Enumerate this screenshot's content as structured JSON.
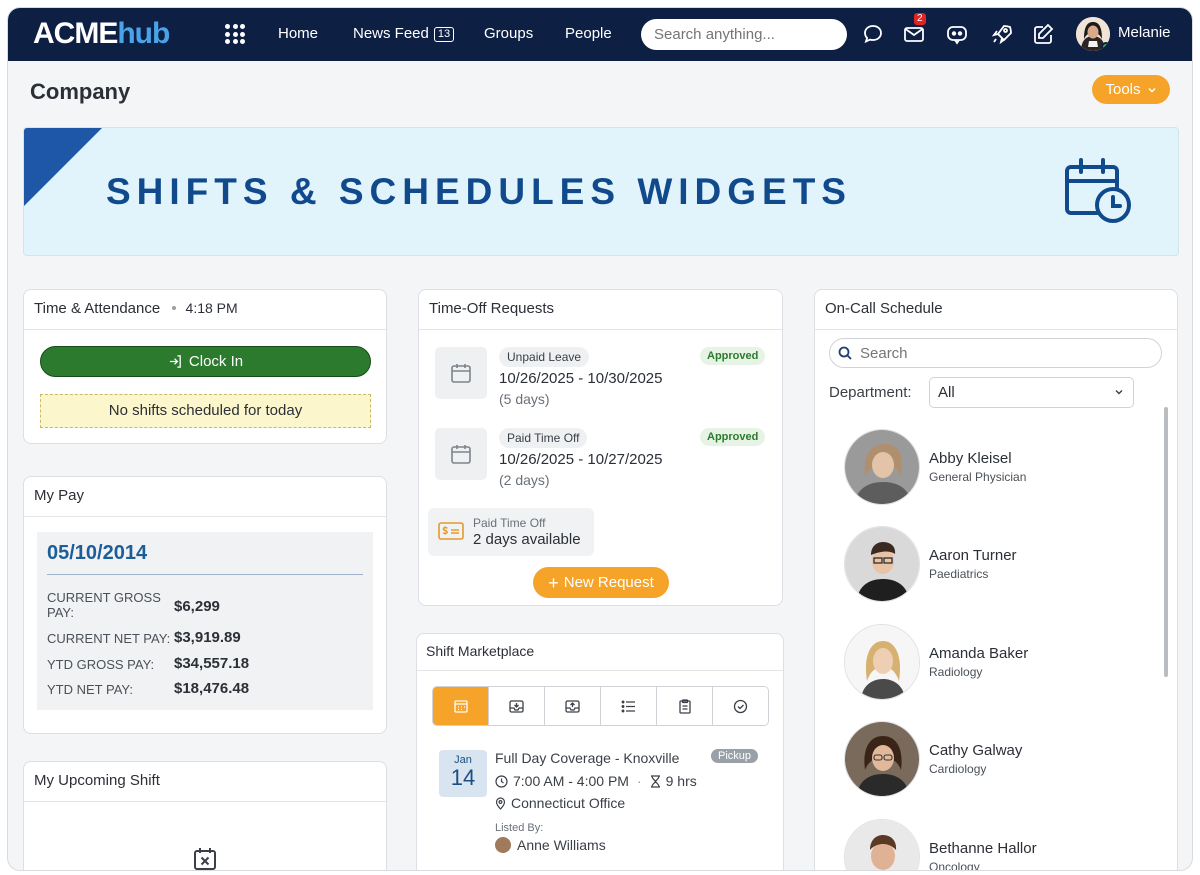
{
  "nav": {
    "logo_main": "ACME",
    "logo_accent": "hub",
    "links": {
      "home": "Home",
      "news_feed": "News Feed",
      "groups": "Groups",
      "people": "People"
    },
    "news_feed_count": "13",
    "search_placeholder": "Search anything...",
    "mail_badge": "2",
    "user_name": "Melanie"
  },
  "page": {
    "title": "Company",
    "tools_label": "Tools"
  },
  "banner": {
    "title": "SHIFTS & SCHEDULES WIDGETS"
  },
  "time_attendance": {
    "title": "Time & Attendance",
    "time": "4:18 PM",
    "clock_in_label": "Clock In",
    "no_shift_text": "No shifts scheduled for today"
  },
  "my_pay": {
    "title": "My Pay",
    "date": "05/10/2014",
    "rows": [
      {
        "label": "CURRENT GROSS PAY:",
        "value": "$6,299"
      },
      {
        "label": "CURRENT NET PAY:",
        "value": "$3,919.89"
      },
      {
        "label": "YTD GROSS PAY:",
        "value": "$34,557.18"
      },
      {
        "label": "YTD NET PAY:",
        "value": "$18,476.48"
      }
    ]
  },
  "upcoming_shift": {
    "title": "My Upcoming Shift"
  },
  "time_off": {
    "title": "Time-Off Requests",
    "requests": [
      {
        "type": "Unpaid Leave",
        "range": "10/26/2025 - 10/30/2025",
        "days": "(5 days)",
        "status": "Approved"
      },
      {
        "type": "Paid Time Off",
        "range": "10/26/2025 - 10/27/2025",
        "days": "(2 days)",
        "status": "Approved"
      }
    ],
    "balance_label": "Paid Time Off",
    "balance_value": "2 days available",
    "new_request_label": "New Request"
  },
  "shift_marketplace": {
    "title": "Shift Marketplace",
    "tab_icons": [
      "calendar-grid-icon",
      "inbox-download-icon",
      "inbox-upload-icon",
      "list-icon",
      "clipboard-icon",
      "check-circle-icon"
    ],
    "shift": {
      "month": "Jan",
      "day": "14",
      "title": "Full Day Coverage - Knoxville",
      "tag": "Pickup",
      "time": "7:00 AM - 4:00 PM",
      "duration": "9 hrs",
      "location": "Connecticut Office",
      "listed_by_label": "Listed By:",
      "listed_by": "Anne Williams"
    }
  },
  "on_call": {
    "title": "On-Call Schedule",
    "search_placeholder": "Search",
    "department_label": "Department:",
    "department_value": "All",
    "people": [
      {
        "name": "Abby Kleisel",
        "dept": "General Physician"
      },
      {
        "name": "Aaron Turner",
        "dept": "Paediatrics"
      },
      {
        "name": "Amanda Baker",
        "dept": "Radiology"
      },
      {
        "name": "Cathy Galway",
        "dept": "Cardiology"
      },
      {
        "name": "Bethanne Hallor",
        "dept": "Oncology"
      }
    ]
  },
  "colors": {
    "nav_bg": "#0e1f44",
    "accent_orange": "#f6a32a",
    "clock_green": "#2b7a2e",
    "banner_bg": "#e2f4fb",
    "banner_text": "#114a8c"
  }
}
